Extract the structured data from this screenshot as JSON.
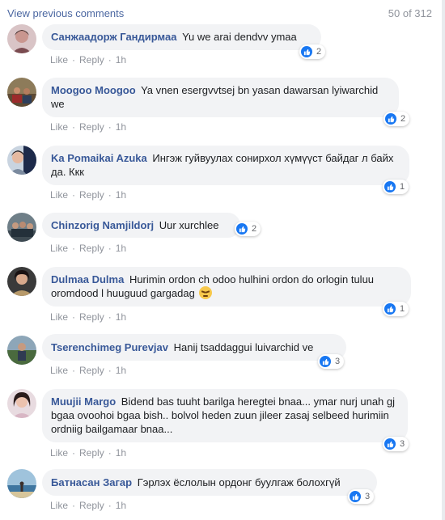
{
  "header": {
    "view_previous": "View previous comments",
    "counter": "50 of 312"
  },
  "actions": {
    "like": "Like",
    "reply": "Reply",
    "dot": "·",
    "time": "1h"
  },
  "comments": [
    {
      "name": "Санжаадорж Гандирмаа",
      "text": "Yu we arai dendvv ymaa",
      "likes": "2"
    },
    {
      "name": "Moogoo Moogoo",
      "text": "Ya vnen esergvvtsej bn yasan dawarsan lyiwarchid we",
      "likes": "2"
    },
    {
      "name": "Ka Pomaikai Azuka",
      "text": "Ингэж гуйвуулах сонирхол хүмүүст байдаг л байх да. Ккк",
      "likes": "1"
    },
    {
      "name": "Chinzorig Namjildorj",
      "text": "Uur xurchlee",
      "likes": "2"
    },
    {
      "name": "Dulmaa Dulma",
      "text": "Hurimin ordon ch odoo hulhini ordon do orlogin tuluu oromdood l huuguud gargadag",
      "likes": "1",
      "emoji": "angry-face-emoji"
    },
    {
      "name": "Tserenchimeg Purevjav",
      "text": "Hanij tsaddaggui luivarchid ve",
      "likes": "3"
    },
    {
      "name": "Muujii Margo",
      "text": "Bidend bas tuuht barilga heregtei bnaa... ymar nurj unah gj bgaa ovoohoi bgaa bish.. bolvol heden zuun jileer zasaj selbeed hurimiin ordniig bailgamaar bnaa...",
      "likes": "3"
    },
    {
      "name": "Батнасан Загар",
      "text": "Гэрлэх ёслолын ордонг буулгаж болохгүй",
      "likes": "3"
    }
  ],
  "colors": {
    "link": "#4b67a1",
    "name": "#385898",
    "bubble": "#f2f3f5",
    "like_blue": "#1877f2",
    "meta": "#90949c"
  }
}
